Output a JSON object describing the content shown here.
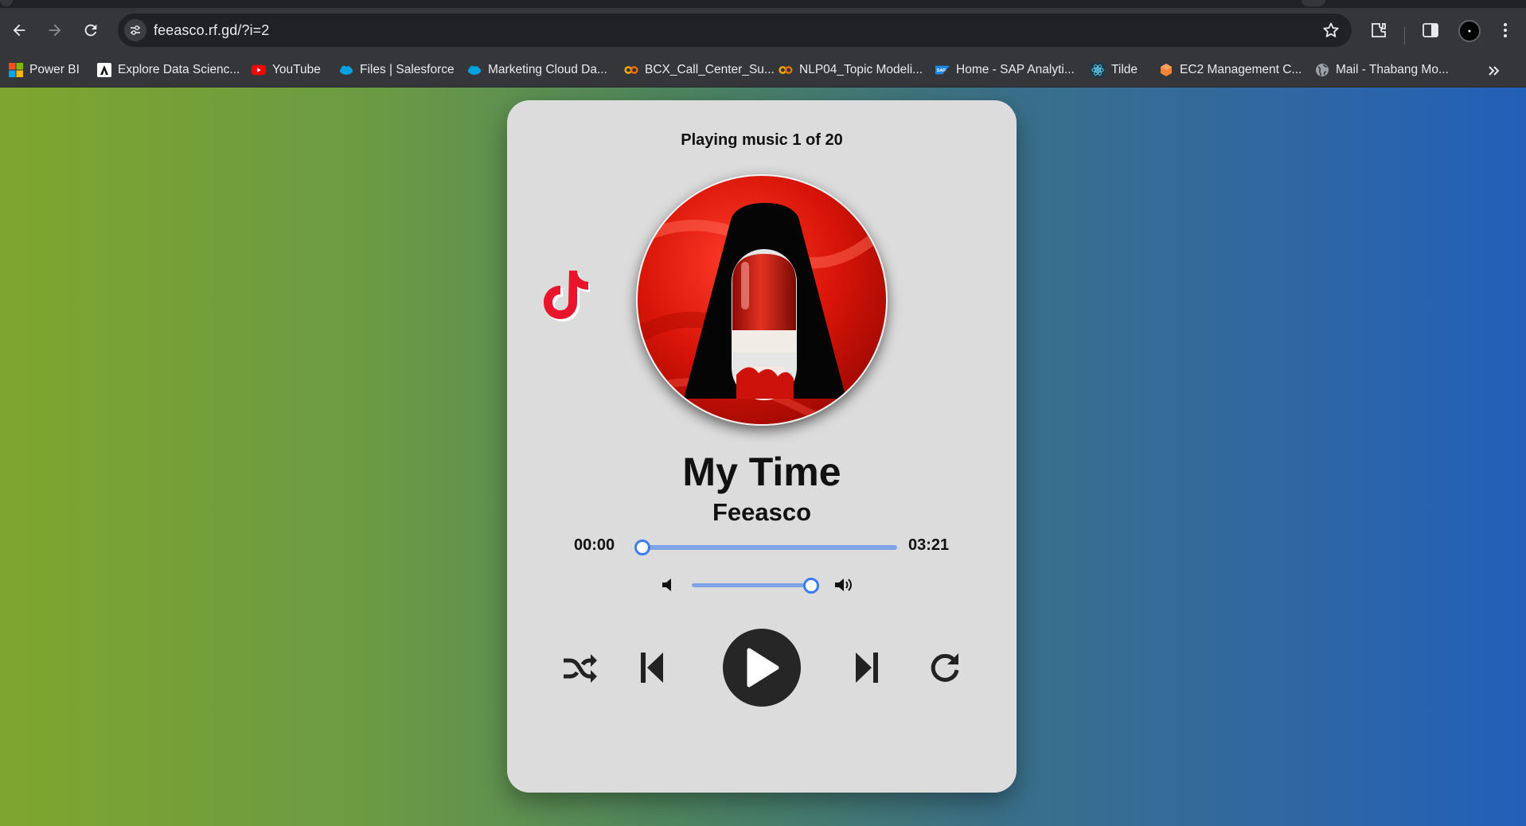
{
  "browser": {
    "url": "feeasco.rf.gd/?i=2",
    "bookmarks": [
      {
        "label": "Power BI",
        "icon": "microsoft-icon"
      },
      {
        "label": "Explore Data Scienc...",
        "icon": "coursera-icon"
      },
      {
        "label": "YouTube",
        "icon": "youtube-icon"
      },
      {
        "label": "Files | Salesforce",
        "icon": "salesforce-icon"
      },
      {
        "label": "Marketing Cloud Da...",
        "icon": "salesforce-icon"
      },
      {
        "label": "BCX_Call_Center_Su...",
        "icon": "colab-icon"
      },
      {
        "label": "NLP04_Topic Modeli...",
        "icon": "colab-icon"
      },
      {
        "label": "Home - SAP Analyti...",
        "icon": "sap-icon"
      },
      {
        "label": "Tilde",
        "icon": "react-icon"
      },
      {
        "label": "EC2 Management C...",
        "icon": "aws-icon"
      },
      {
        "label": "Mail - Thabang Mo...",
        "icon": "globe-icon"
      }
    ],
    "colors": {
      "chrome_bg": "#35363a",
      "omnibox_bg": "#202124",
      "text": "#e8eaed"
    }
  },
  "player": {
    "header": "Playing music 1 of 20",
    "title": "My Time",
    "artist": "Feeasco",
    "current_time": "00:00",
    "duration": "03:21",
    "progress": 0,
    "volume": 1.0,
    "controls": [
      "shuffle-icon",
      "previous-icon",
      "play-icon",
      "next-icon",
      "repeat-icon"
    ],
    "colors": {
      "card_bg": "#dcdcdc",
      "slider": "#7ea4e8",
      "thumb_border": "#3d7bf0",
      "play_button": "#262626"
    }
  }
}
